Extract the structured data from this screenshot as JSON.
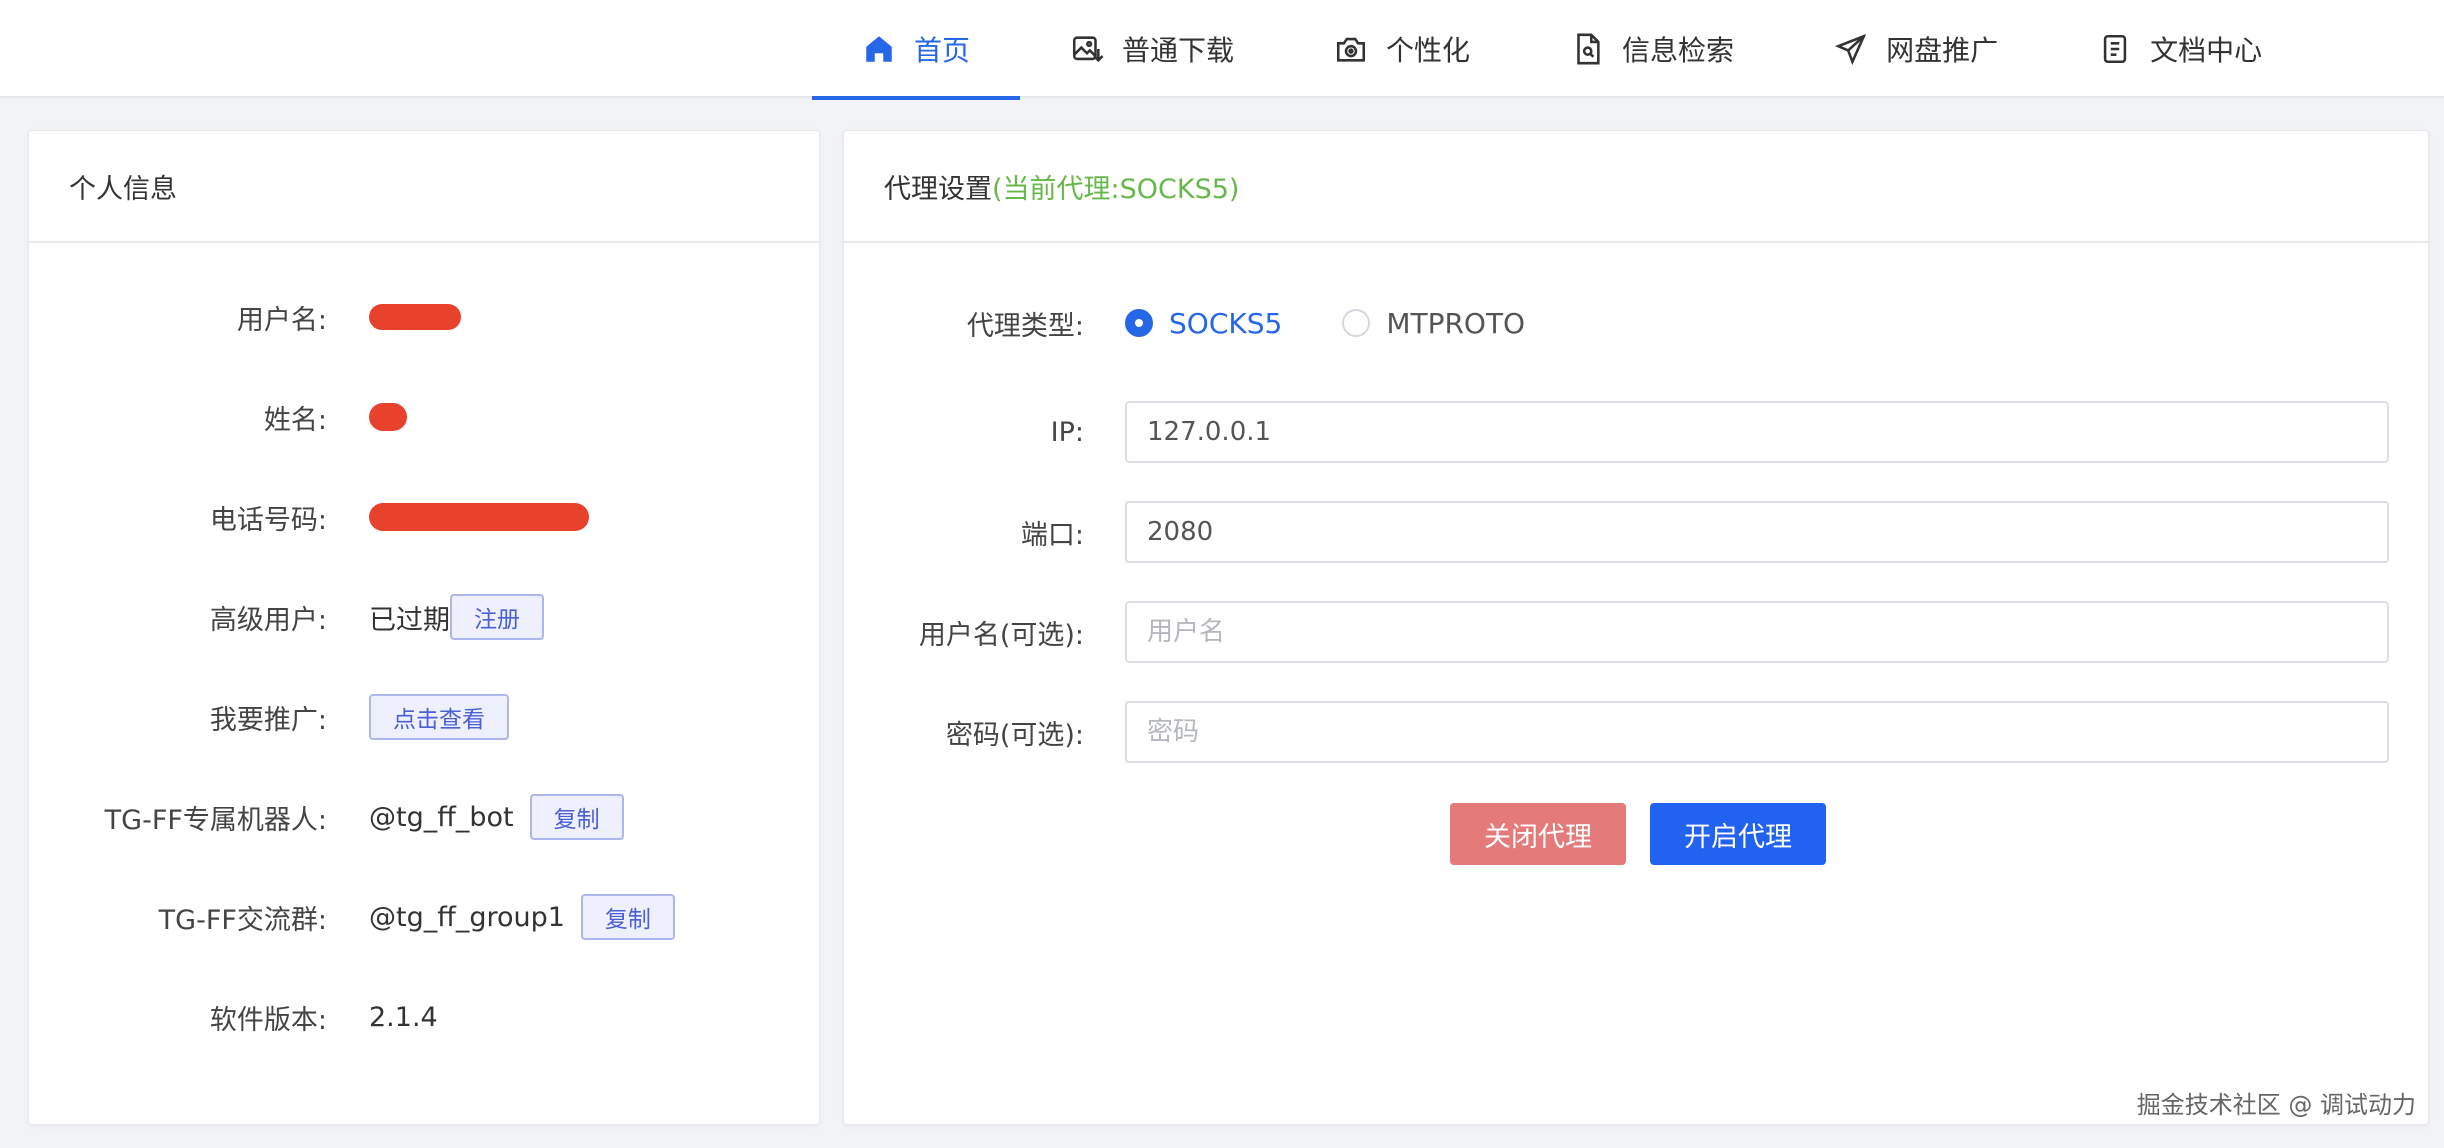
{
  "nav": {
    "items": [
      {
        "label": "首页",
        "icon": "home-icon",
        "active": true
      },
      {
        "label": "普通下载",
        "icon": "image-download-icon",
        "active": false
      },
      {
        "label": "个性化",
        "icon": "camera-gear-icon",
        "active": false
      },
      {
        "label": "信息检索",
        "icon": "file-search-icon",
        "active": false
      },
      {
        "label": "网盘推广",
        "icon": "send-icon",
        "active": false
      },
      {
        "label": "文档中心",
        "icon": "document-icon",
        "active": false
      }
    ],
    "active_color": "#2667e8"
  },
  "profile": {
    "title": "个人信息",
    "username_label": "用户名:",
    "name_label": "姓名:",
    "phone_label": "电话号码:",
    "vip_label": "高级用户:",
    "vip_status": "已过期",
    "vip_register_button": "注册",
    "promote_label": "我要推广:",
    "promote_button": "点击查看",
    "bot_label": "TG-FF专属机器人:",
    "bot_value": "@tg_ff_bot",
    "bot_copy_button": "复制",
    "group_label": "TG-FF交流群:",
    "group_value": "@tg_ff_group1",
    "group_copy_button": "复制",
    "version_label": "软件版本:",
    "version_value": "2.1.4",
    "redaction_color": "#e8412c"
  },
  "proxy": {
    "title": "代理设置",
    "current": "(当前代理:SOCKS5)",
    "type_label": "代理类型:",
    "type_options": [
      {
        "label": "SOCKS5",
        "checked": true
      },
      {
        "label": "MTPROTO",
        "checked": false
      }
    ],
    "ip_label": "IP:",
    "ip_value": "127.0.0.1",
    "port_label": "端口:",
    "port_value": "2080",
    "user_label": "用户名(可选):",
    "user_placeholder": "用户名",
    "pass_label": "密码(可选):",
    "pass_placeholder": "密码",
    "close_button": "关闭代理",
    "open_button": "开启代理"
  },
  "watermark": "掘金技术社区 @ 调试动力"
}
